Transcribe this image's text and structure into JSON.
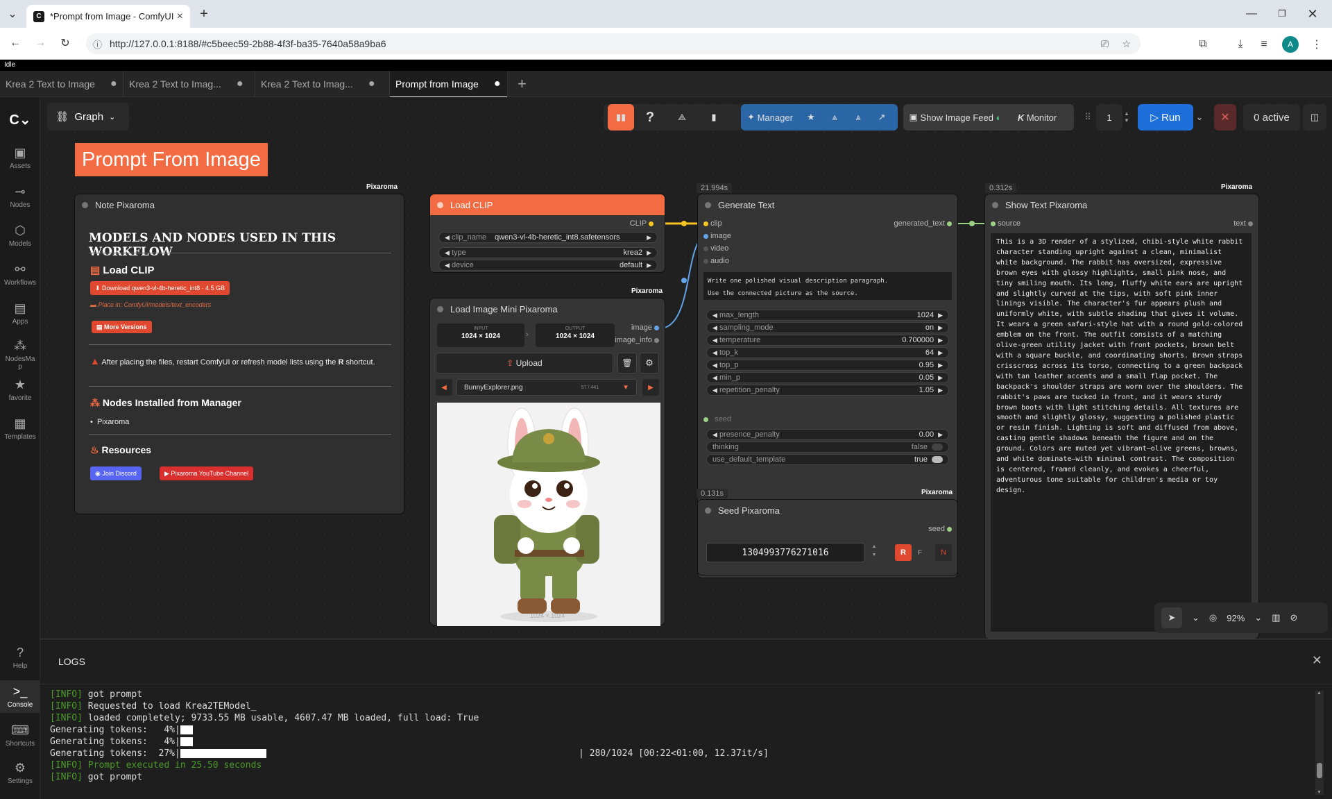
{
  "browser": {
    "tab_title": "*Prompt from Image - ComfyUI",
    "url": "http://127.0.0.1:8188/#c5beec59-2b88-4f3f-ba35-7640a58a9ba6",
    "avatar": "A"
  },
  "status": "Idle",
  "workflow_tabs": [
    {
      "label": "Krea 2 Text to Image"
    },
    {
      "label": "Krea 2 Text to Imag..."
    },
    {
      "label": "Krea 2 Text to Imag..."
    },
    {
      "label": "Prompt from Image"
    }
  ],
  "sidebar": {
    "items": [
      {
        "label": "Assets",
        "icon": "assets-icon"
      },
      {
        "label": "Nodes",
        "icon": "nodes-icon"
      },
      {
        "label": "Models",
        "icon": "models-icon"
      },
      {
        "label": "Workflows",
        "icon": "workflows-icon"
      },
      {
        "label": "Apps",
        "icon": "apps-icon"
      },
      {
        "label": "NodesMa p",
        "icon": "nodes-manager-icon"
      },
      {
        "label": "favorite",
        "icon": "star-icon"
      },
      {
        "label": "Templates",
        "icon": "templates-icon"
      }
    ],
    "bottom": [
      {
        "label": "Help"
      },
      {
        "label": "Console"
      },
      {
        "label": "Shortcuts"
      },
      {
        "label": "Settings"
      }
    ]
  },
  "graph_label": "Graph",
  "toolbar": {
    "manager": "Manager",
    "show_feed": "Show Image Feed",
    "monitor": "Monitor",
    "batch": "1",
    "run": "Run",
    "active": "0 active"
  },
  "canvas_title": "Prompt From Image",
  "pixaroma_badge": "Pixaroma",
  "note": {
    "title": "Note Pixaroma",
    "heading": "MODELS AND NODES USED IN THIS WORKFLOW",
    "load_clip": "Load CLIP",
    "download": "Download qwen3-vl-4b-heretic_int8",
    "download_size": "4.5 GB",
    "place_in": "Place in: ComfyUI/models/text_encoders",
    "more_versions": "More Versions",
    "warning": "After placing the files, restart ComfyUI or refresh model lists using the",
    "warning_key": "R",
    "warning_tail": "shortcut.",
    "nodes_installed": "Nodes Installed from Manager",
    "bullet": "Pixaroma",
    "resources": "Resources",
    "discord": "Join Discord",
    "youtube": "Pixaroma YouTube Channel"
  },
  "load_clip": {
    "title": "Load CLIP",
    "output": "CLIP",
    "widgets": [
      {
        "name": "clip_name",
        "value": "qwen3-vl-4b-heretic_int8.safetensors"
      },
      {
        "name": "type",
        "value": "krea2"
      },
      {
        "name": "device",
        "value": "default"
      }
    ]
  },
  "load_image": {
    "title": "Load Image Mini Pixaroma",
    "input_label": "INPUT",
    "input_value": "1024 × 1024",
    "output_label": "OUTPUT",
    "output_value": "1024 × 1024",
    "out_image": "image",
    "out_info": "image_info",
    "upload": "Upload",
    "filename": "BunnyExplorer.png",
    "counter": "57 / 441",
    "caption": "1024 × 1024"
  },
  "generate": {
    "time": "21.994s",
    "title": "Generate Text",
    "inputs": [
      "clip",
      "image",
      "video",
      "audio"
    ],
    "output": "generated_text",
    "prompt_line1": "Write one polished visual description paragraph.",
    "prompt_line2": "Use the connected picture as the source.",
    "widgets": [
      {
        "name": "max_length",
        "value": "1024"
      },
      {
        "name": "sampling_mode",
        "value": "on"
      },
      {
        "name": "temperature",
        "value": "0.700000"
      },
      {
        "name": "top_k",
        "value": "64"
      },
      {
        "name": "top_p",
        "value": "0.95"
      },
      {
        "name": "min_p",
        "value": "0.05"
      },
      {
        "name": "repetition_penalty",
        "value": "1.05"
      }
    ],
    "seed_label": "seed",
    "presence": {
      "name": "presence_penalty",
      "value": "0.00"
    },
    "thinking": {
      "name": "thinking",
      "value": "false"
    },
    "template": {
      "name": "use_default_template",
      "value": "true"
    }
  },
  "seed": {
    "time": "0.131s",
    "title": "Seed Pixaroma",
    "output": "seed",
    "value": "1304993776271016",
    "r": "R",
    "f": "F",
    "n": "N"
  },
  "show_text": {
    "time": "0.312s",
    "title": "Show Text Pixaroma",
    "input": "source",
    "output": "text",
    "body": "This is a 3D render of a stylized, chibi-style white rabbit character standing upright against a clean, minimalist white background. The rabbit has oversized, expressive brown eyes with glossy highlights, small pink nose, and tiny smiling mouth. Its long, fluffy white ears are upright and slightly curved at the tips, with soft pink inner linings visible. The character's fur appears plush and uniformly white, with subtle shading that gives it volume. It wears a green safari-style hat with a round gold-colored emblem on the front. The outfit consists of a matching olive-green utility jacket with front pockets, brown belt with a square buckle, and coordinating shorts. Brown straps crisscross across its torso, connecting to a green backpack with tan leather accents and a small flap pocket. The backpack's shoulder straps are worn over the shoulders. The rabbit's paws are tucked in front, and it wears sturdy brown boots with light stitching details. All textures are smooth and slightly glossy, suggesting a polished plastic or resin finish. Lighting is soft and diffused from above, casting gentle shadows beneath the figure and on the ground. Colors are muted yet vibrant—olive greens, browns, and white dominate—with minimal contrast. The composition is centered, framed cleanly, and evokes a cheerful, adventurous tone suitable for children's media or toy design."
  },
  "zoom": "92%",
  "logs": {
    "title": "LOGS",
    "lines": [
      {
        "tag": "[INFO]",
        "text": " got prompt"
      },
      {
        "tag": "[INFO]",
        "text": " Requested to load Krea2TEModel_"
      },
      {
        "tag": "[INFO]",
        "text": " loaded completely; 9733.55 MB usable, 4607.47 MB loaded, full load: True"
      }
    ],
    "gen": [
      {
        "text": "Generating tokens:   4%|",
        "progress": 0.04
      },
      {
        "text": "Generating tokens:   4%|",
        "progress": 0.04
      },
      {
        "text": "Generating tokens:  27%|",
        "progress": 0.27,
        "tail": "| 280/1024 [00:22<01:00, 12.37it/s]"
      }
    ],
    "executed": "[INFO] Prompt executed in 25.50 seconds",
    "last": {
      "tag": "[INFO]",
      "text": " got prompt"
    }
  },
  "colors": {
    "accent": "#f26b43",
    "run": "#1e6fd9",
    "manager": "#2b66a6"
  }
}
